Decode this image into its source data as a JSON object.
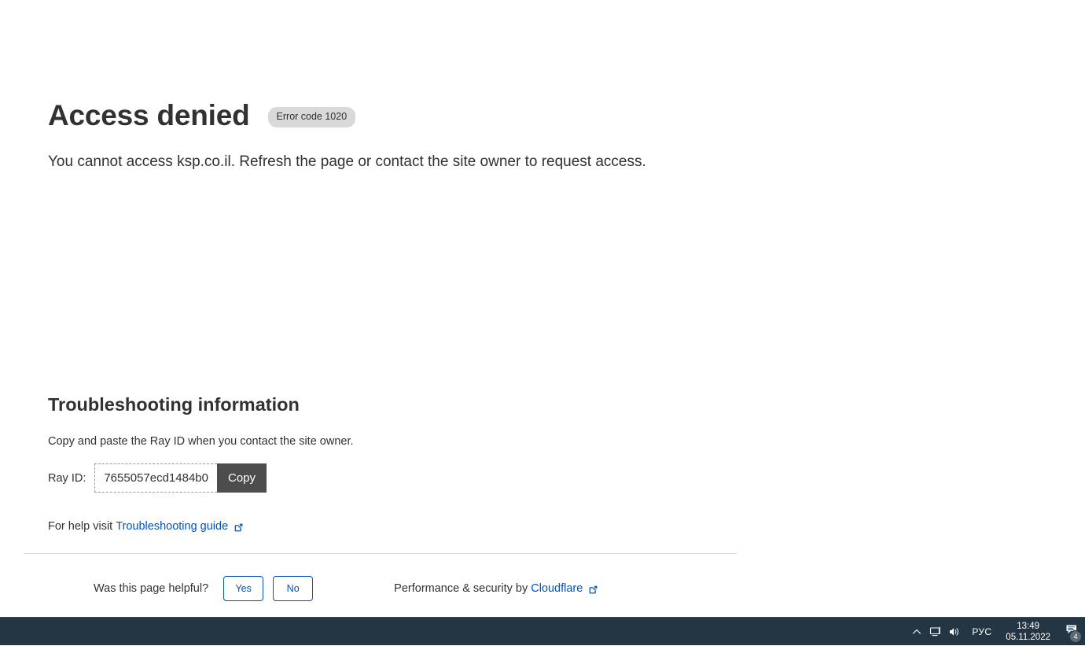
{
  "page": {
    "title": "Access denied",
    "error_code_badge": "Error code 1020",
    "message": "You cannot access ksp.co.il. Refresh the page or contact the site owner to request access.",
    "accent_link_color": "#0051c3",
    "badge_bg_color": "#d9d9d9"
  },
  "troubleshooting": {
    "heading": "Troubleshooting information",
    "description": "Copy and paste the Ray ID when you contact the site owner.",
    "ray_id_label": "Ray ID:",
    "ray_id_value": "7655057ecd1484b0",
    "copy_button_label": "Copy",
    "copy_button_color": "#4d4d4d",
    "help_prefix": "For help visit",
    "help_link_label": "Troubleshooting guide",
    "help_link_icon": "external-link-icon"
  },
  "footer": {
    "feedback_question": "Was this page helpful?",
    "yes_label": "Yes",
    "no_label": "No",
    "attribution_prefix": "Performance & security by",
    "attribution_link": "Cloudflare",
    "attribution_icon": "external-link-icon"
  },
  "taskbar": {
    "background_color": "#243543",
    "show_hidden_icons": "chevron-up-icon",
    "network_icon": "network-monitor-icon",
    "volume_icon": "speaker-icon",
    "language": "РУС",
    "time": "13:49",
    "date": "05.11.2022",
    "notifications_icon": "notifications-icon",
    "notifications_count": "4"
  }
}
